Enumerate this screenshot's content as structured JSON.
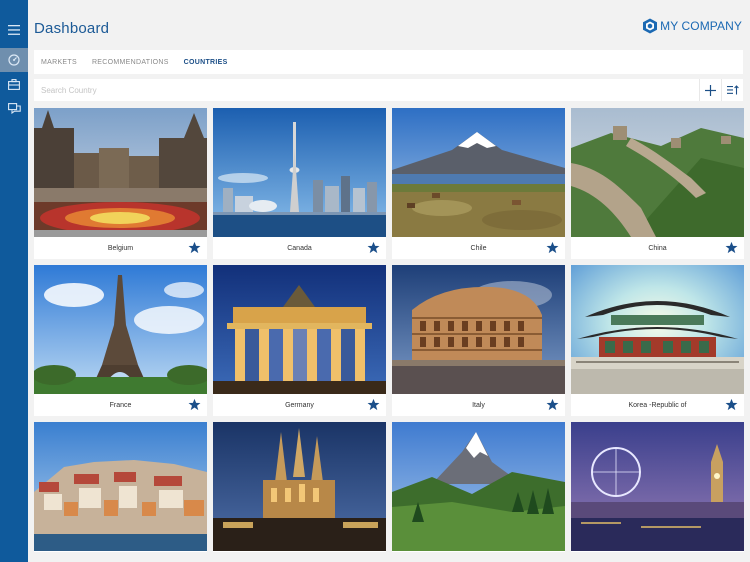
{
  "header": {
    "title": "Dashboard",
    "brand": "MY COMPANY"
  },
  "sidebar": {
    "items": [
      "menu-icon",
      "dashboard-icon",
      "briefcase-icon",
      "chat-icon"
    ]
  },
  "tabs": [
    {
      "label": "MARKETS",
      "active": false
    },
    {
      "label": "RECOMMENDATIONS",
      "active": false
    },
    {
      "label": "COUNTRIES",
      "active": true
    }
  ],
  "search": {
    "placeholder": "Search Country",
    "value": ""
  },
  "countries": [
    {
      "name": "Belgium",
      "favorite": true
    },
    {
      "name": "Canada",
      "favorite": true
    },
    {
      "name": "Chile",
      "favorite": true
    },
    {
      "name": "China",
      "favorite": true
    },
    {
      "name": "France",
      "favorite": true
    },
    {
      "name": "Germany",
      "favorite": true
    },
    {
      "name": "Italy",
      "favorite": true
    },
    {
      "name": "Korea -Republic of",
      "favorite": true
    },
    {
      "name": "",
      "favorite": false
    },
    {
      "name": "",
      "favorite": false
    },
    {
      "name": "",
      "favorite": false
    },
    {
      "name": "",
      "favorite": false
    }
  ],
  "colors": {
    "sidebar": "#0f5a9c",
    "accent": "#1c4f87",
    "brand": "#1b69b3"
  }
}
